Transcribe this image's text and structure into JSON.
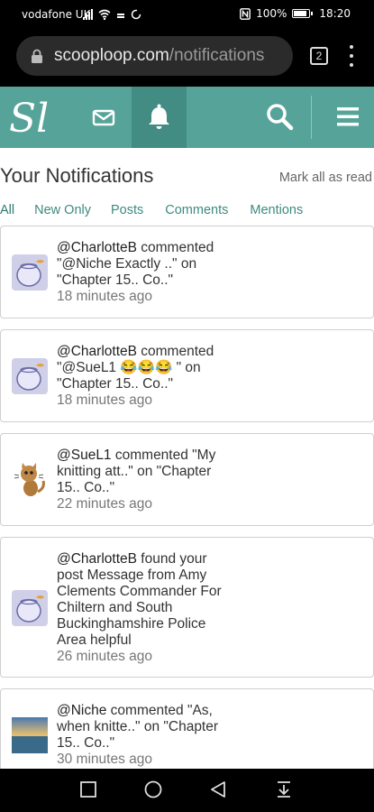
{
  "status_bar": {
    "carrier": "vodafone UK",
    "battery": "100%",
    "time": "18:20"
  },
  "browser": {
    "url_domain": "scooploop.com",
    "url_path": "/notifications",
    "tab_count": "2"
  },
  "nav": {
    "logo_text": "Sl"
  },
  "page": {
    "title": "Your Notifications",
    "mark_all": "Mark all as read",
    "filters": [
      "All",
      "New Only",
      "Posts",
      "Comments",
      "Mentions"
    ]
  },
  "notifications": [
    {
      "user": "@CharlotteB",
      "text": " commented \"@Niche Exactly ..\" on \"Chapter 15.. Co..\"",
      "time": "18 minutes ago",
      "avatar": "fishbowl-avatar"
    },
    {
      "user": "@CharlotteB",
      "text": " commented \"@SueL1 😂😂😂 \" on \"Chapter 15.. Co..\"",
      "time": "18 minutes ago",
      "avatar": "fishbowl-avatar"
    },
    {
      "user": "@SueL1",
      "text": " commented \"My knitting att..\" on \"Chapter 15.. Co..\"",
      "time": "22 minutes ago",
      "avatar": "cat-avatar"
    },
    {
      "user": "@CharlotteB",
      "text": " found your post Message from Amy Clements Commander For Chiltern and South Buckinghamshire Police Area helpful",
      "time": "26 minutes ago",
      "avatar": "fishbowl-avatar"
    },
    {
      "user": "@Niche",
      "text": " commented \"As, when knitte..\" on \"Chapter 15.. Co..\"",
      "time": "30 minutes ago",
      "avatar": "seascape-avatar"
    }
  ],
  "colors": {
    "nav_bg": "#55a399",
    "nav_active": "#428c83",
    "link": "#3d8a80"
  }
}
